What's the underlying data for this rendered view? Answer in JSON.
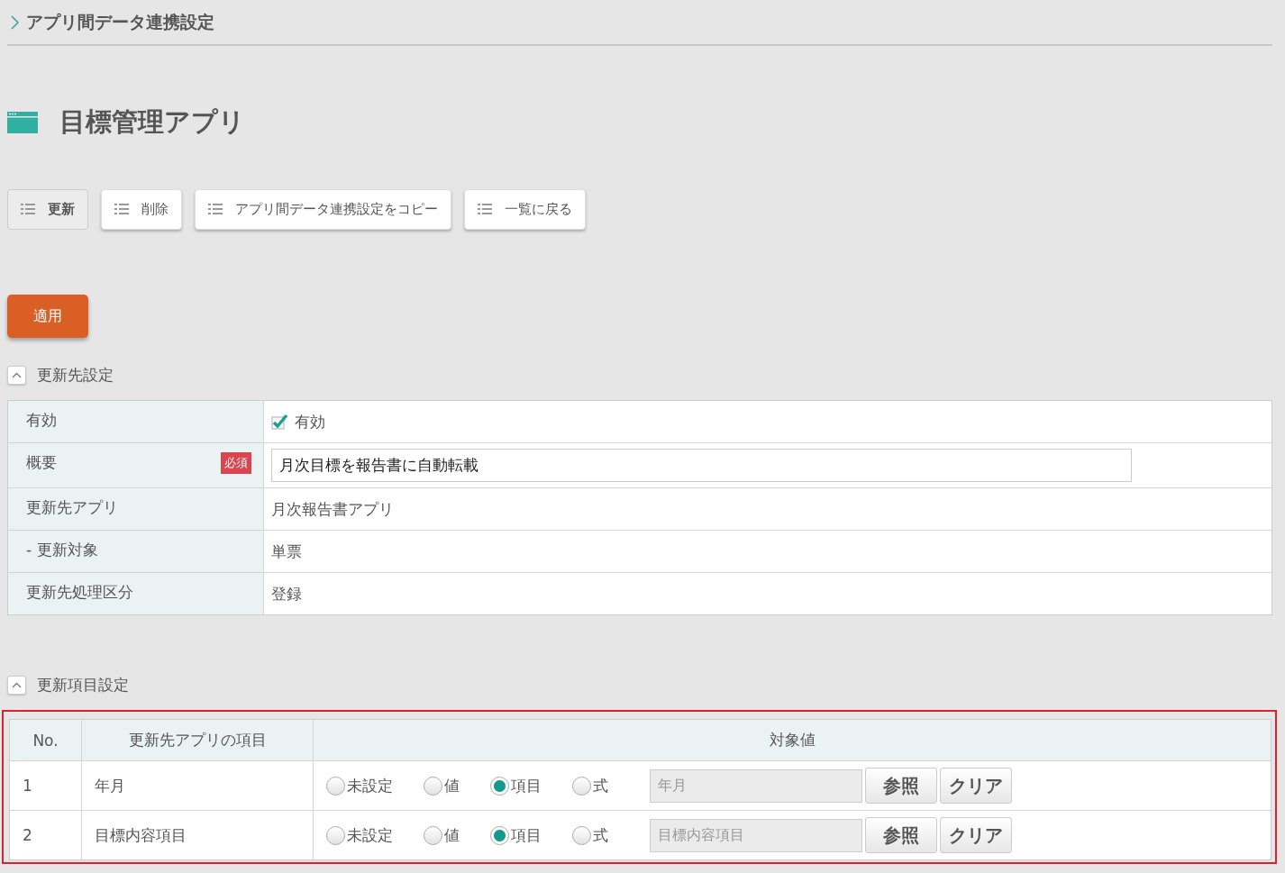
{
  "breadcrumb": {
    "title": "アプリ間データ連携設定"
  },
  "page_title": "目標管理アプリ",
  "toolbar": [
    {
      "label": "更新",
      "selected": true
    },
    {
      "label": "削除",
      "selected": false
    },
    {
      "label": "アプリ間データ連携設定をコピー",
      "selected": false
    },
    {
      "label": "一覧に戻る",
      "selected": false
    }
  ],
  "apply_button": "適用",
  "destination_section": {
    "title": "更新先設定",
    "expanded": true,
    "rows": [
      {
        "kind": "checkbox",
        "label": "有効",
        "checked": true,
        "value": "有効"
      },
      {
        "kind": "input",
        "label": "概要",
        "required_badge": "必須",
        "value": "月次目標を報告書に自動転載"
      },
      {
        "kind": "text",
        "label": "更新先アプリ",
        "value": "月次報告書アプリ"
      },
      {
        "kind": "text",
        "label": "- 更新対象",
        "value": "単票"
      },
      {
        "kind": "text",
        "label": "更新先処理区分",
        "value": "登録"
      }
    ]
  },
  "items_section": {
    "title": "更新項目設定",
    "expanded": true,
    "highlighted": true,
    "columns": [
      "No.",
      "更新先アプリの項目",
      "対象値"
    ],
    "rows": [
      {
        "no": "1",
        "item": "年月",
        "options": [
          {
            "label": "未設定",
            "selected": false
          },
          {
            "label": "値",
            "selected": false
          },
          {
            "label": "項目",
            "selected": true
          },
          {
            "label": "式",
            "selected": false
          }
        ],
        "field_value": "年月",
        "buttons": [
          "参照",
          "クリア"
        ]
      },
      {
        "no": "2",
        "item": "目標内容項目",
        "options": [
          {
            "label": "未設定",
            "selected": false
          },
          {
            "label": "値",
            "selected": false
          },
          {
            "label": "項目",
            "selected": true
          },
          {
            "label": "式",
            "selected": false
          }
        ],
        "field_value": "目標内容項目",
        "buttons": [
          "参照",
          "クリア"
        ]
      }
    ]
  }
}
